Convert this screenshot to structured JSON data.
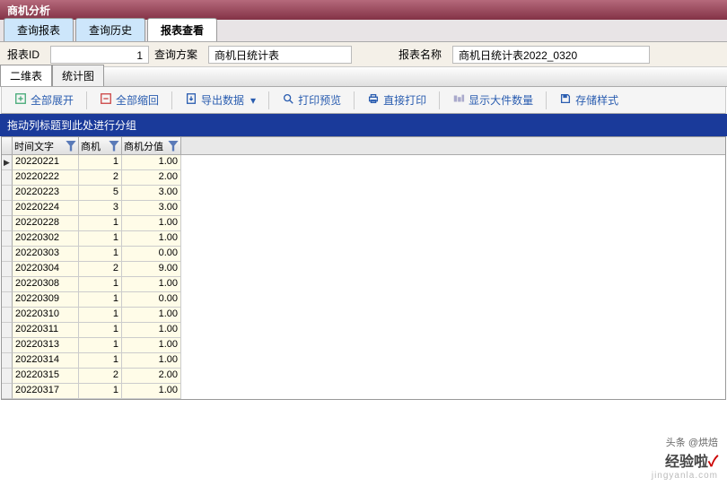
{
  "window": {
    "title": "商机分析"
  },
  "tabs": [
    {
      "label": "查询报表",
      "active": false
    },
    {
      "label": "查询历史",
      "active": false
    },
    {
      "label": "报表查看",
      "active": true
    }
  ],
  "info": {
    "report_id_label": "报表ID",
    "report_id": "1",
    "plan_label": "查询方案",
    "plan_value": "商机日统计表",
    "name_label": "报表名称",
    "name_value": "商机日统计表2022_0320"
  },
  "sub_tabs": [
    {
      "label": "二维表",
      "active": true
    },
    {
      "label": "统计图",
      "active": false
    }
  ],
  "toolbar": [
    {
      "icon": "expand",
      "label": "全部展开"
    },
    {
      "icon": "collapse",
      "label": "全部缩回"
    },
    {
      "icon": "export",
      "label": "导出数据",
      "dropdown": true
    },
    {
      "icon": "preview",
      "label": "打印预览"
    },
    {
      "icon": "print",
      "label": "直接打印"
    },
    {
      "icon": "count",
      "label": "显示大件数量"
    },
    {
      "icon": "save",
      "label": "存储样式"
    }
  ],
  "group_panel": {
    "text": "拖动列标题到此处进行分组"
  },
  "columns": [
    {
      "label": "时间文字"
    },
    {
      "label": "商机"
    },
    {
      "label": "商机分值"
    }
  ],
  "rows": [
    {
      "date": "20220221",
      "count": 1,
      "score": "1.00"
    },
    {
      "date": "20220222",
      "count": 2,
      "score": "2.00"
    },
    {
      "date": "20220223",
      "count": 5,
      "score": "3.00"
    },
    {
      "date": "20220224",
      "count": 3,
      "score": "3.00"
    },
    {
      "date": "20220228",
      "count": 1,
      "score": "1.00"
    },
    {
      "date": "20220302",
      "count": 1,
      "score": "1.00"
    },
    {
      "date": "20220303",
      "count": 1,
      "score": "0.00"
    },
    {
      "date": "20220304",
      "count": 2,
      "score": "9.00"
    },
    {
      "date": "20220308",
      "count": 1,
      "score": "1.00"
    },
    {
      "date": "20220309",
      "count": 1,
      "score": "0.00"
    },
    {
      "date": "20220310",
      "count": 1,
      "score": "1.00"
    },
    {
      "date": "20220311",
      "count": 1,
      "score": "1.00"
    },
    {
      "date": "20220313",
      "count": 1,
      "score": "1.00"
    },
    {
      "date": "20220314",
      "count": 1,
      "score": "1.00"
    },
    {
      "date": "20220315",
      "count": 2,
      "score": "2.00"
    },
    {
      "date": "20220317",
      "count": 1,
      "score": "1.00"
    }
  ],
  "watermark": {
    "line1": "头条 @烘焙",
    "logo_main": "经验啦",
    "logo_check": "✓",
    "url": "jingyanla.com"
  },
  "chart_data": {
    "type": "table",
    "title": "商机日统计表2022_0320",
    "columns": [
      "时间文字",
      "商机",
      "商机分值"
    ],
    "rows": [
      [
        "20220221",
        1,
        1.0
      ],
      [
        "20220222",
        2,
        2.0
      ],
      [
        "20220223",
        5,
        3.0
      ],
      [
        "20220224",
        3,
        3.0
      ],
      [
        "20220228",
        1,
        1.0
      ],
      [
        "20220302",
        1,
        1.0
      ],
      [
        "20220303",
        1,
        0.0
      ],
      [
        "20220304",
        2,
        9.0
      ],
      [
        "20220308",
        1,
        1.0
      ],
      [
        "20220309",
        1,
        0.0
      ],
      [
        "20220310",
        1,
        1.0
      ],
      [
        "20220311",
        1,
        1.0
      ],
      [
        "20220313",
        1,
        1.0
      ],
      [
        "20220314",
        1,
        1.0
      ],
      [
        "20220315",
        2,
        2.0
      ],
      [
        "20220317",
        1,
        1.0
      ]
    ]
  }
}
